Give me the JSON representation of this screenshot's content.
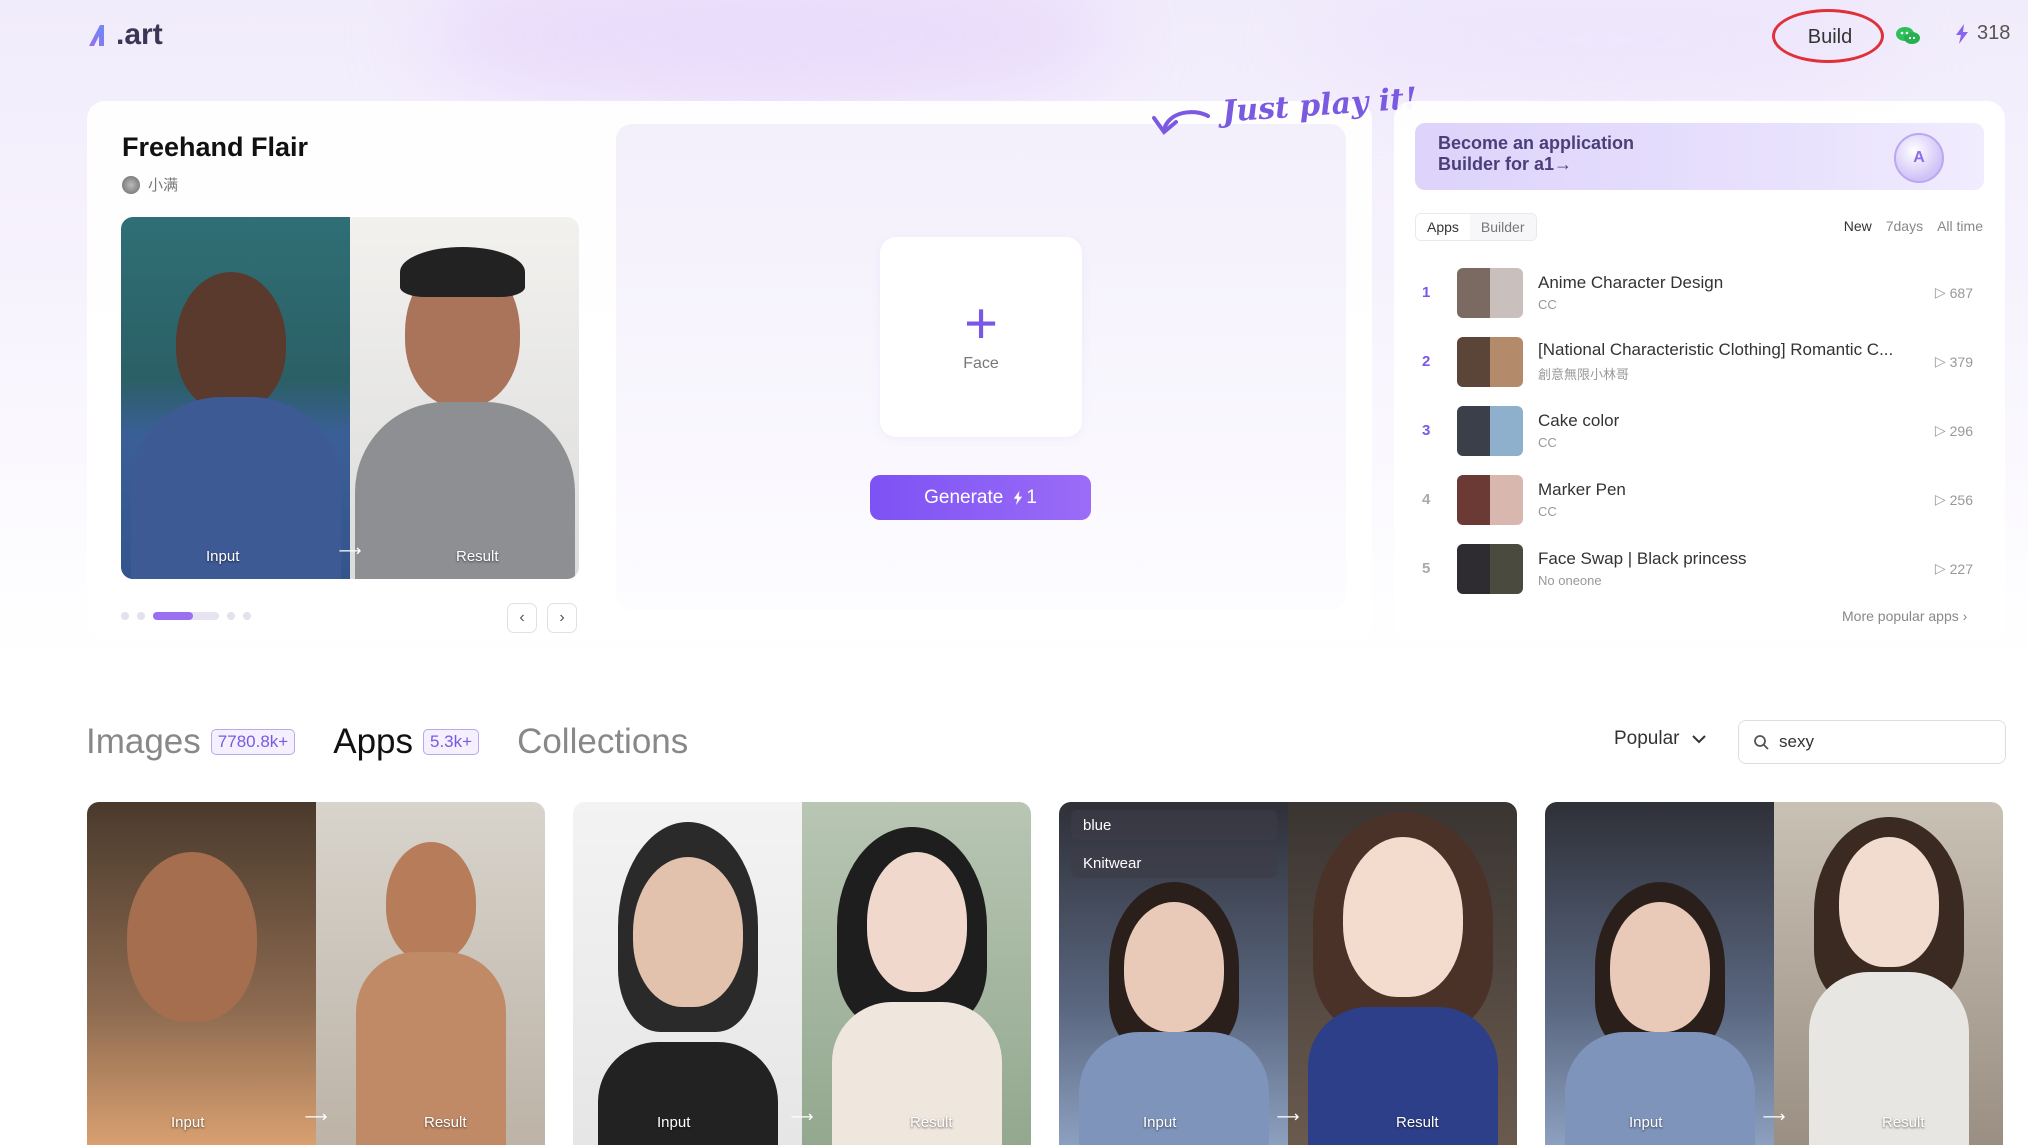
{
  "brand": {
    "logo_text": ".art",
    "logo_mark": "a1-logo"
  },
  "topbar": {
    "build_label": "Build",
    "credits": "318"
  },
  "hero": {
    "title": "Freehand Flair",
    "author": "小满",
    "input_caption": "Input",
    "result_caption": "Result",
    "upload_label": "Face",
    "generate_label": "Generate",
    "generate_cost": "1",
    "just_play": "Just play it!"
  },
  "ranking": {
    "banner_line1": "Become an application",
    "banner_line2": "Builder for a1→",
    "tabs": [
      "Apps",
      "Builder"
    ],
    "periods": [
      "New",
      "7days",
      "All time"
    ],
    "items": [
      {
        "rank": "1",
        "name": "Anime Character Design",
        "author": "CC",
        "runs": "687"
      },
      {
        "rank": "2",
        "name": "[National Characteristic Clothing] Romantic C...",
        "author": "創意無限小林哥",
        "runs": "379"
      },
      {
        "rank": "3",
        "name": "Cake color",
        "author": "CC",
        "runs": "296"
      },
      {
        "rank": "4",
        "name": "Marker Pen",
        "author": "CC",
        "runs": "256"
      },
      {
        "rank": "5",
        "name": "Face Swap | Black princess",
        "author": "No oneone",
        "runs": "227"
      }
    ],
    "more_label": "More popular apps"
  },
  "sections": {
    "images_label": "Images",
    "images_count": "7780.8k+",
    "apps_label": "Apps",
    "apps_count": "5.3k+",
    "collections_label": "Collections"
  },
  "filters": {
    "sort_value": "Popular",
    "search_value": "sexy"
  },
  "gallery": {
    "input_caption": "Input",
    "result_caption": "Result",
    "tags": [
      "blue",
      "Knitwear"
    ]
  }
}
